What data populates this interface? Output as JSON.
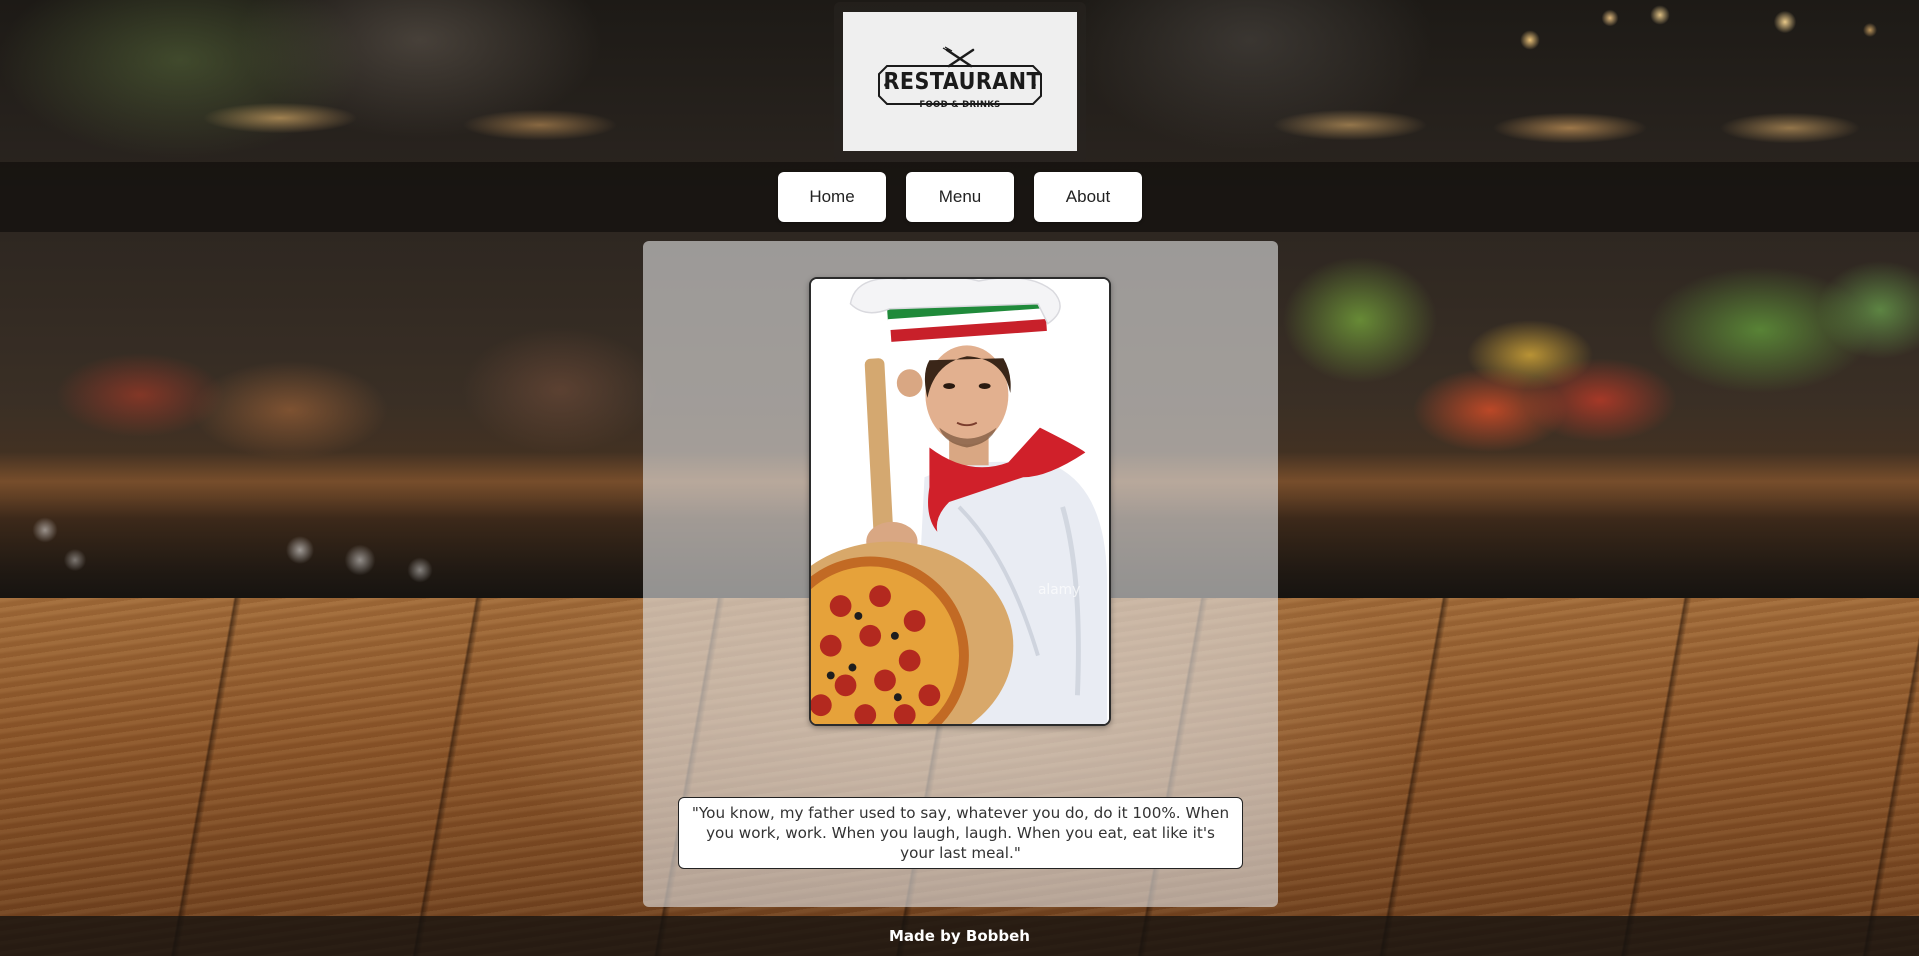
{
  "logo": {
    "title": "RESTAURANT",
    "subtitle": "FOOD & DRINKS",
    "icon": "crossed-fork-knife-icon"
  },
  "nav": {
    "items": [
      {
        "label": "Home"
      },
      {
        "label": "Menu"
      },
      {
        "label": "About"
      }
    ]
  },
  "main": {
    "image_watermark": "alamy",
    "quote": "\"You know, my father used to say, whatever you do, do it 100%. When you work, work. When you laugh, laugh. When you eat, eat like it's your last meal.\""
  },
  "footer": {
    "credit": "Made by Bobbeh"
  },
  "colors": {
    "nav_button_bg": "#ffffff",
    "navbar_bg": "#120f0c",
    "panel_bg": "#e1e1e1",
    "chef_scarf": "#d0202a",
    "hat_band_green": "#1f8a3a"
  }
}
